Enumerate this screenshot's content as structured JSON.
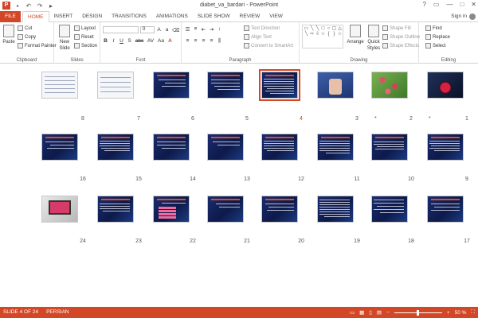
{
  "window": {
    "title": "diabet_va_bardari - PowerPoint",
    "app_logo": "P",
    "controls": [
      "?",
      "▭",
      "—",
      "□",
      "✕"
    ]
  },
  "quick_access": [
    "save-icon",
    "undo-icon",
    "redo-icon",
    "start-presentation-icon"
  ],
  "tabs": {
    "file": "FILE",
    "items": [
      "HOME",
      "INSERT",
      "DESIGN",
      "TRANSITIONS",
      "ANIMATIONS",
      "SLIDE SHOW",
      "REVIEW",
      "VIEW"
    ],
    "active": "HOME",
    "sign_in": "Sign in"
  },
  "ribbon": {
    "clipboard": {
      "label": "Clipboard",
      "paste": "Paste",
      "cut": "Cut",
      "copy": "Copy",
      "format_painter": "Format Painter"
    },
    "slides": {
      "label": "Slides",
      "new_slide": "New",
      "new_slide_2": "Slide",
      "layout": "Layout",
      "reset": "Reset",
      "section": "Section"
    },
    "font": {
      "label": "Font",
      "font_size": "0",
      "format_buttons": [
        "B",
        "I",
        "U",
        "S",
        "abc",
        "AV",
        "Aa",
        "A"
      ]
    },
    "paragraph": {
      "label": "Paragraph",
      "text_direction": "Text Direction",
      "align_text": "Align Text",
      "convert_smartart": "Convert to SmartArt"
    },
    "drawing": {
      "label": "Drawing",
      "arrange": "Arrange",
      "quick_styles": "Quick",
      "quick_styles_2": "Styles",
      "shape_fill": "Shape Fill",
      "shape_outline": "Shape Outline",
      "shape_effects": "Shape Effects"
    },
    "editing": {
      "label": "Editing",
      "find": "Find",
      "replace": "Replace",
      "select": "Select"
    }
  },
  "slides": {
    "row1": [
      "8",
      "7",
      "6",
      "5",
      "4",
      "3",
      "2",
      "1"
    ],
    "row2": [
      "16",
      "15",
      "14",
      "13",
      "12",
      "11",
      "10",
      "9"
    ],
    "row3": [
      "24",
      "23",
      "22",
      "21",
      "20",
      "19",
      "18",
      "17"
    ],
    "selected": "4",
    "star_marks": [
      "*",
      "*"
    ]
  },
  "status": {
    "slide_info": "SLIDE 4 OF 24",
    "language": "PERSIAN",
    "zoom": "50 %",
    "zoom_minus": "−",
    "zoom_plus": "+"
  }
}
